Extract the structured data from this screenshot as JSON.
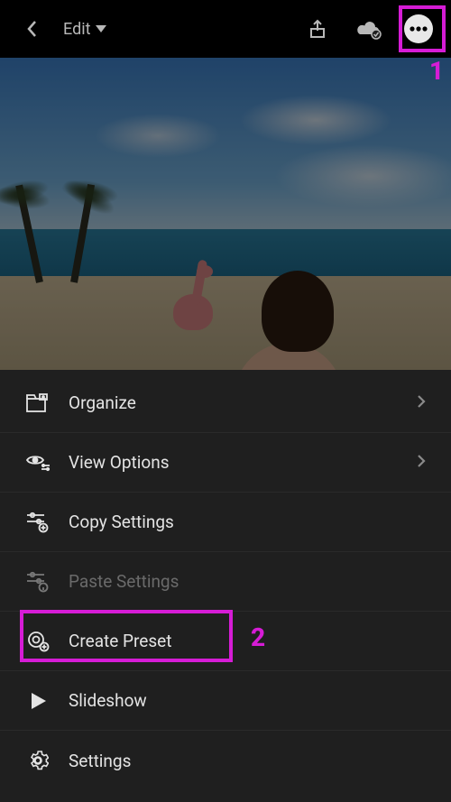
{
  "header": {
    "title": "Edit"
  },
  "menu": {
    "items": [
      {
        "label": "Organize",
        "has_chevron": true,
        "disabled": false
      },
      {
        "label": "View Options",
        "has_chevron": true,
        "disabled": false
      },
      {
        "label": "Copy Settings",
        "has_chevron": false,
        "disabled": false
      },
      {
        "label": "Paste Settings",
        "has_chevron": false,
        "disabled": true
      },
      {
        "label": "Create Preset",
        "has_chevron": false,
        "disabled": false
      },
      {
        "label": "Slideshow",
        "has_chevron": false,
        "disabled": false
      },
      {
        "label": "Settings",
        "has_chevron": false,
        "disabled": false
      }
    ]
  },
  "annotations": {
    "callout_1": "1",
    "callout_2": "2"
  }
}
